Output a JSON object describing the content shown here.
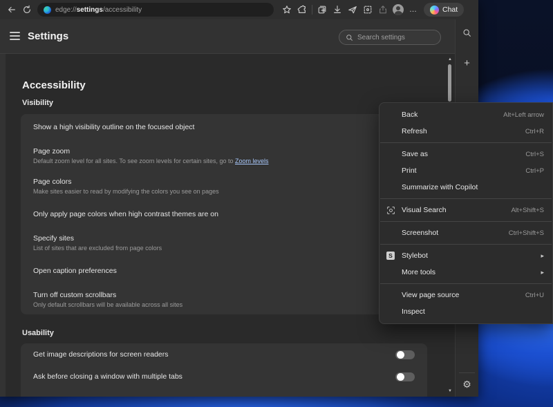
{
  "browser": {
    "url": {
      "prefix": "edge://",
      "bold": "settings",
      "suffix": "/accessibility"
    },
    "chat_label": "Chat"
  },
  "settings": {
    "title": "Settings",
    "search_placeholder": "Search settings",
    "page_title": "Accessibility",
    "visibility": {
      "heading": "Visibility",
      "rows": [
        {
          "label": "Show a high visibility outline on the focused object"
        },
        {
          "label": "Page zoom",
          "desc": "Default zoom level for all sites. To see zoom levels for certain sites, go to ",
          "link": "Zoom levels"
        },
        {
          "label": "Page colors",
          "desc": "Make sites easier to read by modifying the colors you see on pages"
        },
        {
          "label": "Only apply page colors when high contrast themes are on"
        },
        {
          "label": "Specify sites",
          "desc": "List of sites that are excluded from page colors"
        },
        {
          "label": "Open caption preferences"
        },
        {
          "label": "Turn off custom scrollbars",
          "desc": "Only default scrollbars will be available across all sites"
        }
      ]
    },
    "usability": {
      "heading": "Usability",
      "rows": [
        {
          "label": "Get image descriptions for screen readers",
          "toggle": "off"
        },
        {
          "label": "Ask before closing a window with multiple tabs",
          "toggle": "off"
        }
      ]
    }
  },
  "context_menu": {
    "stylebot_badge": "S",
    "items": [
      {
        "label": "Back",
        "shortcut": "Alt+Left arrow"
      },
      {
        "label": "Refresh",
        "shortcut": "Ctrl+R"
      },
      {
        "label": "Save as",
        "shortcut": "Ctrl+S"
      },
      {
        "label": "Print",
        "shortcut": "Ctrl+P"
      },
      {
        "label": "Summarize with Copilot",
        "shortcut": ""
      },
      {
        "label": "Visual Search",
        "shortcut": "Alt+Shift+S"
      },
      {
        "label": "Screenshot",
        "shortcut": "Ctrl+Shift+S"
      },
      {
        "label": "Stylebot",
        "shortcut": ""
      },
      {
        "label": "More tools",
        "shortcut": ""
      },
      {
        "label": "View page source",
        "shortcut": "Ctrl+U"
      },
      {
        "label": "Inspect",
        "shortcut": ""
      }
    ]
  },
  "icons": {
    "ellipsis": "…",
    "submenu_arrow": "▸",
    "scroll_up": "▲",
    "scroll_down": "▼",
    "gear": "⚙",
    "plus": "+"
  },
  "colors": {
    "link": "#a8c7fa",
    "menu_bg": "#2c2c2c",
    "card_bg": "#343434",
    "toggle_off": "#5e5e5e",
    "wallpaper_blue": "#2a66e8"
  }
}
